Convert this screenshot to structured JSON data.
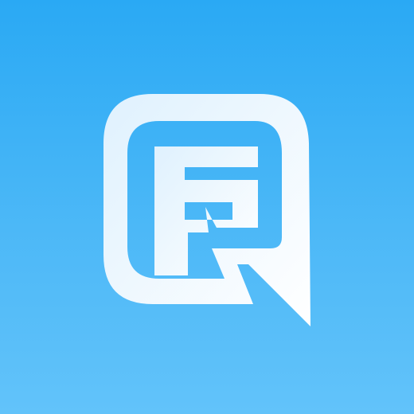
{
  "app_icon": {
    "icon_name": "app-logo-icon",
    "colors": {
      "background_top": "#2aa9f4",
      "background_bottom": "#62c3fa",
      "mark": "#eaf6ff"
    }
  }
}
